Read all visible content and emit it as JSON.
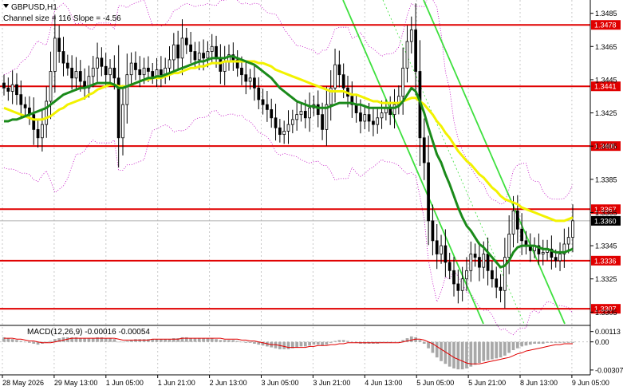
{
  "chart_data": [
    {
      "type": "candlestick",
      "title": "GBPUSD,H1",
      "subtitle": "Channel size = 116 Slope = -4.56",
      "y_ticks": [
        "1.3485",
        "1.3465",
        "1.3445",
        "1.3425",
        "1.3405",
        "1.3385",
        "1.3365",
        "1.3345",
        "1.3325",
        "1.3305"
      ],
      "ylim": [
        1.3297,
        1.3493
      ],
      "x_ticks": [
        "28 May 2026",
        "29 May 13:00",
        "1 Jun 05:00",
        "1 Jun 21:00",
        "2 Jun 13:00",
        "3 Jun 05:00",
        "3 Jun 21:00",
        "4 Jun 13:00",
        "5 Jun 05:00",
        "5 Jun 21:00",
        "8 Jun 13:00",
        "9 Jun 05:00"
      ],
      "levels": [
        {
          "label": "1.3478",
          "value": 1.3478
        },
        {
          "label": "1.3441",
          "value": 1.3441
        },
        {
          "label": "1.3405",
          "value": 1.3405
        },
        {
          "label": "1.3367",
          "value": 1.3367
        },
        {
          "label": "1.3336",
          "value": 1.3336
        },
        {
          "label": "1.3307",
          "value": 1.3307
        }
      ],
      "current_price": {
        "label": "1.3360",
        "value": 1.336
      },
      "close": [
        1.344,
        1.3438,
        1.3442,
        1.3436,
        1.343,
        1.3428,
        1.3424,
        1.3415,
        1.341,
        1.3418,
        1.3432,
        1.345,
        1.347,
        1.3462,
        1.3455,
        1.3452,
        1.3446,
        1.345,
        1.3444,
        1.344,
        1.3447,
        1.3452,
        1.3458,
        1.3453,
        1.3448,
        1.3452,
        1.3446,
        1.341,
        1.343,
        1.3448,
        1.3455,
        1.3451,
        1.3448,
        1.3452,
        1.345,
        1.3447,
        1.3451,
        1.3448,
        1.3452,
        1.3457,
        1.3466,
        1.3458,
        1.347,
        1.3466,
        1.3462,
        1.3457,
        1.3461,
        1.3458,
        1.3462,
        1.3465,
        1.3458,
        1.345,
        1.3456,
        1.346,
        1.3457,
        1.3452,
        1.3448,
        1.3444,
        1.3446,
        1.344,
        1.3433,
        1.343,
        1.3427,
        1.3422,
        1.3416,
        1.3412,
        1.3414,
        1.3418,
        1.3421,
        1.3424,
        1.3426,
        1.3422,
        1.3428,
        1.343,
        1.3424,
        1.3415,
        1.343,
        1.344,
        1.3454,
        1.3448,
        1.344,
        1.3435,
        1.343,
        1.3425,
        1.342,
        1.3424,
        1.342,
        1.3418,
        1.3422,
        1.3425,
        1.3428,
        1.3424,
        1.343,
        1.3435,
        1.3452,
        1.3468,
        1.3475,
        1.345,
        1.341,
        1.3395,
        1.336,
        1.3348,
        1.334,
        1.3345,
        1.3335,
        1.333,
        1.3322,
        1.3318,
        1.3325,
        1.333,
        1.334,
        1.3338,
        1.3332,
        1.334,
        1.333,
        1.3325,
        1.332,
        1.3318,
        1.3338,
        1.3352,
        1.3366,
        1.3355,
        1.3348,
        1.3345,
        1.3342,
        1.3345,
        1.334,
        1.3341,
        1.3343,
        1.3338,
        1.3336,
        1.334,
        1.3346,
        1.335,
        1.336
      ],
      "moving_averages": [
        {
          "color": "#f2f200",
          "values": [
            1.3428,
            1.3427,
            1.3426,
            1.3425,
            1.3424,
            1.3423,
            1.3422,
            1.3421,
            1.3421,
            1.3421,
            1.3422,
            1.3423,
            1.3425,
            1.3427,
            1.3428,
            1.343,
            1.3431,
            1.3432,
            1.3433,
            1.3434,
            1.3436,
            1.3437,
            1.3439,
            1.344,
            1.3441,
            1.3442,
            1.3442,
            1.3441,
            1.3441,
            1.3441,
            1.3442,
            1.3443,
            1.3444,
            1.3445,
            1.3445,
            1.3446,
            1.3446,
            1.3446,
            1.3447,
            1.3448,
            1.3449,
            1.3449,
            1.345,
            1.3451,
            1.3452,
            1.3452,
            1.3453,
            1.3453,
            1.3454,
            1.3455,
            1.3455,
            1.3455,
            1.3456,
            1.3456,
            1.3456,
            1.3456,
            1.3456,
            1.3456,
            1.3456,
            1.3456,
            1.3455,
            1.3455,
            1.3454,
            1.3453,
            1.3451,
            1.345,
            1.3449,
            1.3448,
            1.3447,
            1.3446,
            1.3445,
            1.3444,
            1.3443,
            1.3442,
            1.3441,
            1.344,
            1.3439,
            1.3438,
            1.3438,
            1.3438,
            1.3438,
            1.3437,
            1.3436,
            1.3436,
            1.3435,
            1.3434,
            1.3433,
            1.3432,
            1.3432,
            1.3431,
            1.3431,
            1.3431,
            1.3431,
            1.3431,
            1.3432,
            1.3433,
            1.3434,
            1.3434,
            1.3432,
            1.343,
            1.3427,
            1.3424,
            1.342,
            1.3417,
            1.3413,
            1.341,
            1.3406,
            1.3402,
            1.3399,
            1.3396,
            1.3394,
            1.3391,
            1.3388,
            1.3386,
            1.3383,
            1.338,
            1.3378,
            1.3375,
            1.3373,
            1.3372,
            1.3371,
            1.337,
            1.3368,
            1.3367,
            1.3366,
            1.3365,
            1.3364,
            1.3363,
            1.3362,
            1.3361,
            1.336,
            1.336,
            1.336,
            1.3361,
            1.3362
          ]
        },
        {
          "color": "#1a8a1a",
          "values": [
            1.342,
            1.342,
            1.3421,
            1.3421,
            1.3422,
            1.3423,
            1.3424,
            1.3425,
            1.3426,
            1.3427,
            1.3428,
            1.343,
            1.3432,
            1.3434,
            1.3436,
            1.3437,
            1.3438,
            1.3439,
            1.344,
            1.344,
            1.3441,
            1.3442,
            1.3443,
            1.3443,
            1.3443,
            1.3443,
            1.3442,
            1.344,
            1.344,
            1.3441,
            1.3442,
            1.3443,
            1.3444,
            1.3445,
            1.3446,
            1.3446,
            1.3447,
            1.3447,
            1.3448,
            1.3449,
            1.345,
            1.3451,
            1.3452,
            1.3453,
            1.3454,
            1.3455,
            1.3456,
            1.3456,
            1.3457,
            1.3458,
            1.3458,
            1.3458,
            1.3458,
            1.3459,
            1.3459,
            1.3458,
            1.3457,
            1.3456,
            1.3455,
            1.3454,
            1.3452,
            1.345,
            1.3448,
            1.3446,
            1.3443,
            1.344,
            1.3438,
            1.3436,
            1.3434,
            1.3432,
            1.3431,
            1.343,
            1.3429,
            1.3429,
            1.3428,
            1.3428,
            1.3428,
            1.3429,
            1.343,
            1.3431,
            1.3431,
            1.3431,
            1.3431,
            1.343,
            1.343,
            1.3429,
            1.3428,
            1.3428,
            1.3428,
            1.3428,
            1.3428,
            1.3428,
            1.3428,
            1.3429,
            1.3432,
            1.3436,
            1.344,
            1.3438,
            1.3432,
            1.3425,
            1.3416,
            1.3408,
            1.34,
            1.3395,
            1.3388,
            1.3382,
            1.3375,
            1.3368,
            1.3362,
            1.3357,
            1.3354,
            1.335,
            1.3346,
            1.3344,
            1.3341,
            1.3338,
            1.3335,
            1.3332,
            1.3333,
            1.3336,
            1.3341,
            1.3344,
            1.3345,
            1.3345,
            1.3345,
            1.3345,
            1.3344,
            1.3343,
            1.3343,
            1.3342,
            1.3341,
            1.3341,
            1.3341,
            1.3342,
            1.3343
          ]
        }
      ]
    },
    {
      "type": "bar",
      "title": "MACD(12,26,9) -0.00016 -0.00054",
      "y_ticks": [
        "0.00113",
        "0.00",
        "-0.00307"
      ],
      "ylim": [
        -0.0036,
        0.0018
      ],
      "macd": [
        0.0005,
        0.0004,
        0.0003,
        0.0002,
        0.0001,
        0.0,
        -0.0001,
        -0.0002,
        -0.0003,
        -0.0002,
        -0.0001,
        0.0001,
        0.0003,
        0.0004,
        0.0005,
        0.0005,
        0.0005,
        0.0005,
        0.0004,
        0.0004,
        0.0004,
        0.0004,
        0.0005,
        0.0005,
        0.0004,
        0.0004,
        0.0003,
        0.0,
        0.0,
        0.0001,
        0.0002,
        0.0003,
        0.0003,
        0.0003,
        0.0003,
        0.0003,
        0.0003,
        0.0003,
        0.0003,
        0.0003,
        0.0004,
        0.0004,
        0.0005,
        0.0005,
        0.0004,
        0.0004,
        0.0004,
        0.0004,
        0.0004,
        0.0004,
        0.0003,
        0.0002,
        0.0002,
        0.0002,
        0.0002,
        0.0001,
        0.0,
        -0.0001,
        -0.0001,
        -0.0002,
        -0.0003,
        -0.0004,
        -0.0005,
        -0.0006,
        -0.0007,
        -0.0008,
        -0.0008,
        -0.0008,
        -0.0007,
        -0.0006,
        -0.0005,
        -0.0005,
        -0.0004,
        -0.0003,
        -0.0003,
        -0.0004,
        -0.0003,
        -0.0001,
        0.0001,
        0.0002,
        0.0002,
        0.0001,
        0.0,
        -0.0001,
        -0.0002,
        -0.0002,
        -0.0002,
        -0.0002,
        -0.0002,
        -0.0001,
        -0.0001,
        -0.0001,
        0.0,
        0.0,
        0.0002,
        0.0004,
        0.0006,
        0.0005,
        0.0002,
        -0.0002,
        -0.0007,
        -0.0012,
        -0.0017,
        -0.0021,
        -0.0024,
        -0.0027,
        -0.0029,
        -0.003,
        -0.003,
        -0.0029,
        -0.0027,
        -0.0025,
        -0.0023,
        -0.0021,
        -0.002,
        -0.0019,
        -0.0018,
        -0.0017,
        -0.0015,
        -0.0012,
        -0.0009,
        -0.0007,
        -0.0005,
        -0.0004,
        -0.0003,
        -0.0002,
        -0.0002,
        -0.0002,
        -0.0001,
        -0.0001,
        -0.0001,
        -0.0001,
        -0.0001,
        -0.0001,
        -0.0001
      ],
      "signal": [
        0.0004,
        0.0004,
        0.0004,
        0.0003,
        0.0003,
        0.0002,
        0.0001,
        0.0001,
        0.0,
        -0.0001,
        -0.0001,
        -0.0001,
        0.0,
        0.0001,
        0.0002,
        0.0003,
        0.0004,
        0.0004,
        0.0004,
        0.0004,
        0.0004,
        0.0004,
        0.0004,
        0.0004,
        0.0004,
        0.0004,
        0.0004,
        0.0003,
        0.0002,
        0.0002,
        0.0002,
        0.0002,
        0.0002,
        0.0002,
        0.0002,
        0.0003,
        0.0003,
        0.0003,
        0.0003,
        0.0003,
        0.0003,
        0.0003,
        0.0004,
        0.0004,
        0.0004,
        0.0004,
        0.0004,
        0.0004,
        0.0004,
        0.0004,
        0.0004,
        0.0004,
        0.0003,
        0.0003,
        0.0003,
        0.0003,
        0.0002,
        0.0002,
        0.0001,
        0.0001,
        0.0,
        -0.0001,
        -0.0002,
        -0.0003,
        -0.0003,
        -0.0004,
        -0.0005,
        -0.0006,
        -0.0006,
        -0.0006,
        -0.0006,
        -0.0006,
        -0.0005,
        -0.0005,
        -0.0004,
        -0.0004,
        -0.0004,
        -0.0003,
        -0.0003,
        -0.0002,
        -0.0002,
        -0.0001,
        -0.0001,
        -0.0001,
        -0.0001,
        -0.0001,
        -0.0001,
        -0.0001,
        -0.0001,
        -0.0001,
        -0.0001,
        -0.0001,
        -0.0001,
        -0.0001,
        0.0,
        0.0001,
        0.0002,
        0.0003,
        0.0003,
        0.0002,
        0.0,
        -0.0002,
        -0.0005,
        -0.0008,
        -0.0011,
        -0.0014,
        -0.0017,
        -0.0019,
        -0.0021,
        -0.0023,
        -0.0024,
        -0.0024,
        -0.0024,
        -0.0023,
        -0.0022,
        -0.0021,
        -0.002,
        -0.0019,
        -0.0018,
        -0.0017,
        -0.0015,
        -0.0013,
        -0.0012,
        -0.001,
        -0.0009,
        -0.0008,
        -0.0007,
        -0.0006,
        -0.0005,
        -0.0004,
        -0.0003,
        -0.0003,
        -0.0002,
        -0.0002,
        -0.0002
      ]
    }
  ]
}
